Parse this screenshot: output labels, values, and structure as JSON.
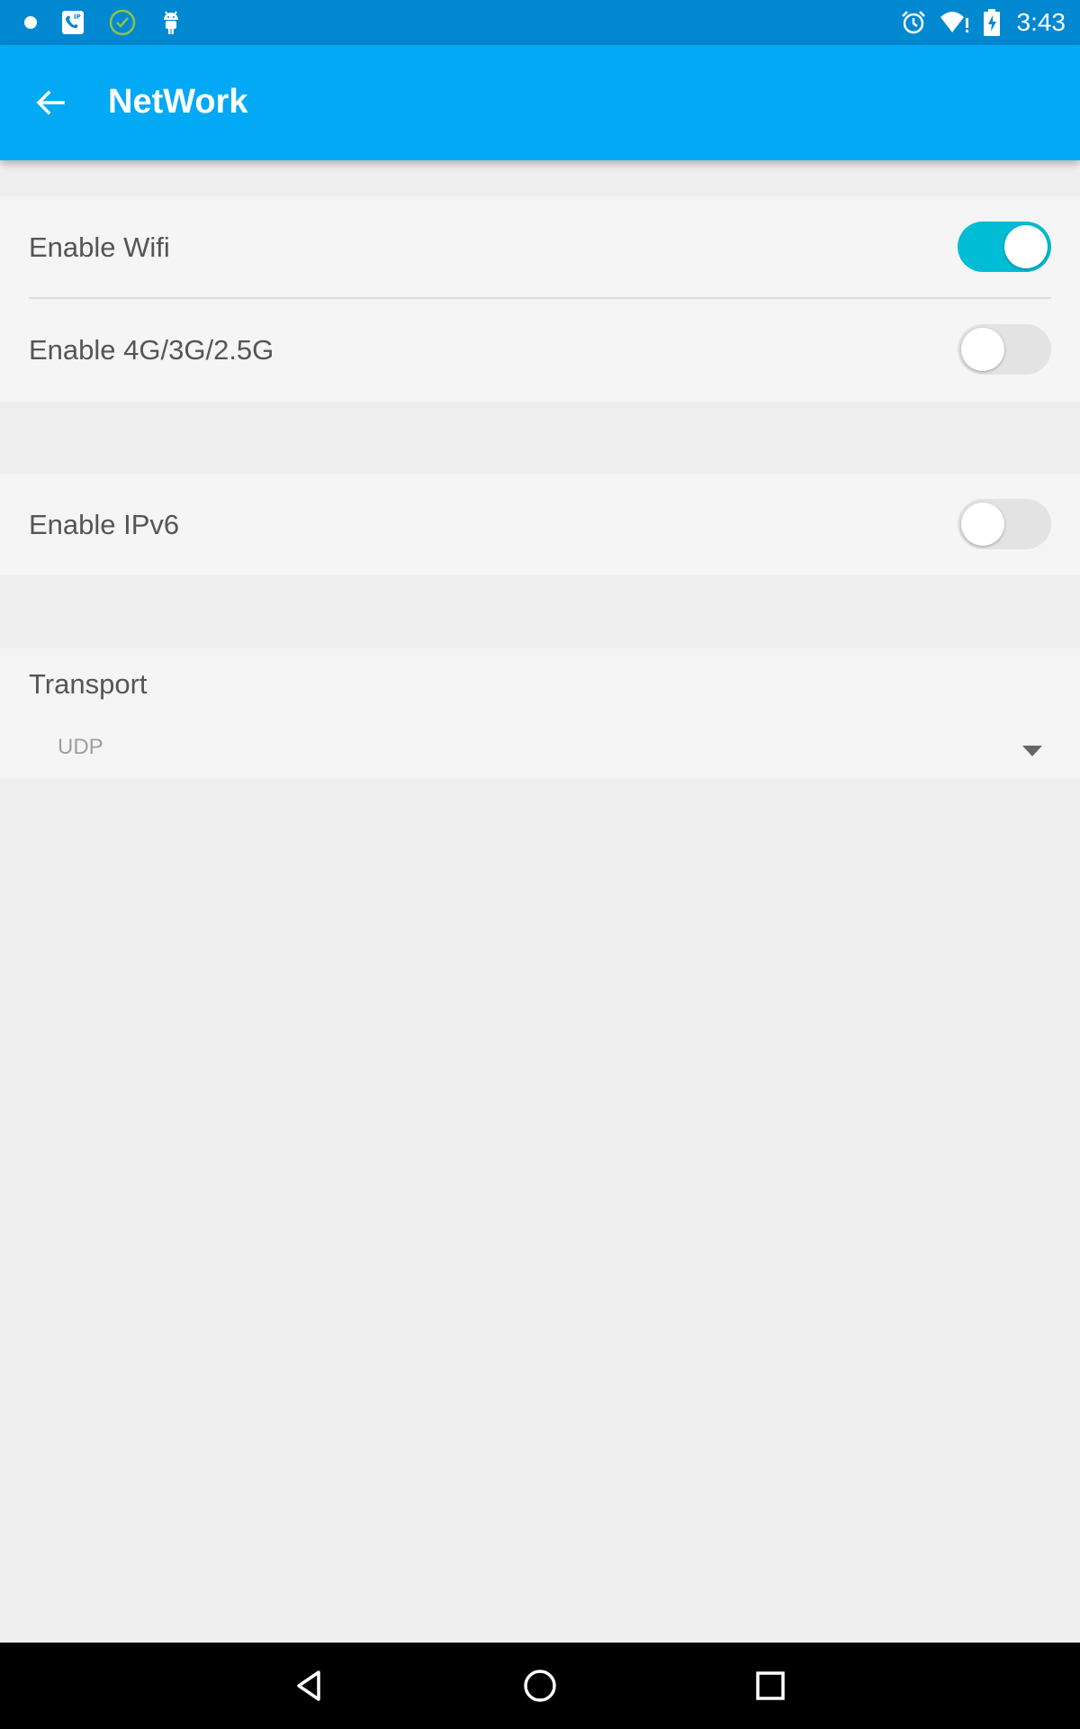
{
  "status_bar": {
    "time": "3:43",
    "left_icons": [
      "dot-icon",
      "voip-app-icon",
      "check-circle-icon",
      "android-icon"
    ],
    "right_icons": [
      "alarm-icon",
      "wifi-alert-icon",
      "battery-charging-icon"
    ]
  },
  "app_bar": {
    "title": "NetWork",
    "back_icon": "arrow-back-icon",
    "color": "#03a9f4"
  },
  "settings": {
    "wifi": {
      "label": "Enable Wifi",
      "enabled": true
    },
    "mobile": {
      "label": "Enable 4G/3G/2.5G",
      "enabled": false
    },
    "ipv6": {
      "label": "Enable IPv6",
      "enabled": false
    }
  },
  "transport": {
    "label": "Transport",
    "selected": "UDP"
  },
  "colors": {
    "status_bar": "#0288d1",
    "switch_on": "#00bcd4",
    "switch_off": "#e3e3e3",
    "background": "#eeeeee",
    "section": "#f5f5f5"
  },
  "nav_bar": {
    "icons": [
      "back-triangle-icon",
      "home-circle-icon",
      "recents-square-icon"
    ]
  }
}
